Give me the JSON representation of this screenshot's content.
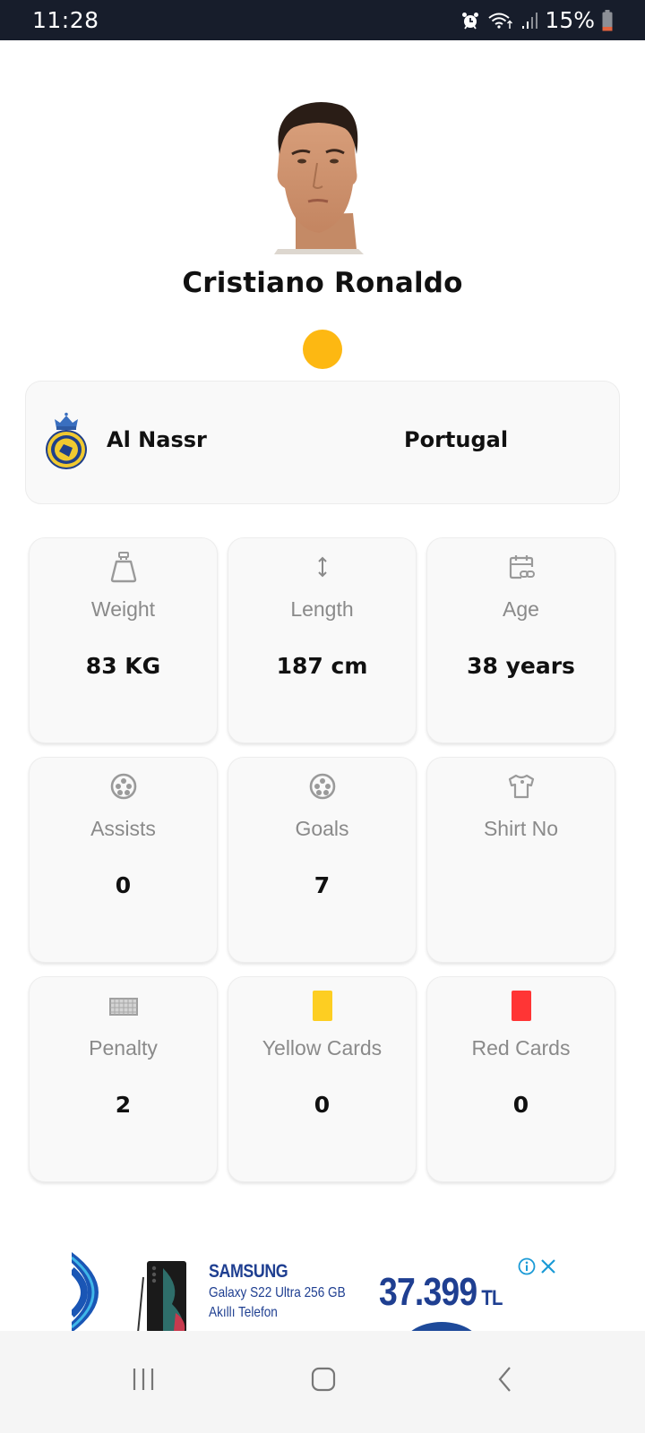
{
  "status_bar": {
    "time": "11:28",
    "battery_percent": "15%",
    "icons": [
      "alarm-icon",
      "wifi-icon",
      "signal-icon",
      "battery-icon"
    ]
  },
  "player": {
    "name": "Cristiano Ronaldo",
    "status_dot_color": "#fdb812"
  },
  "club_card": {
    "club_name": "Al Nassr",
    "country": "Portugal"
  },
  "stats": [
    {
      "icon": "weight-icon",
      "label": "Weight",
      "value": "83 KG"
    },
    {
      "icon": "height-arrows-icon",
      "label": "Length",
      "value": "187 cm"
    },
    {
      "icon": "calendar-age-icon",
      "label": "Age",
      "value": "38 years"
    },
    {
      "icon": "soccer-ball-icon",
      "label": "Assists",
      "value": "0"
    },
    {
      "icon": "soccer-ball-icon",
      "label": "Goals",
      "value": "7"
    },
    {
      "icon": "shirt-icon",
      "label": "Shirt No",
      "value": ""
    },
    {
      "icon": "goal-net-icon",
      "label": "Penalty",
      "value": "2"
    },
    {
      "icon": "yellow-card-icon",
      "label": "Yellow Cards",
      "value": "0"
    },
    {
      "icon": "red-card-icon",
      "label": "Red Cards",
      "value": "0"
    }
  ],
  "colors": {
    "yellow_card": "#fdce22",
    "red_card": "#ff3535",
    "icon_gray": "#9a9a9a"
  },
  "ad": {
    "brand": "SAMSUNG",
    "model": "Galaxy S22 Ultra 256 GB",
    "description": "Akıllı Telefon",
    "price": "37.399",
    "currency": "TL"
  },
  "nav_bar": {
    "buttons": [
      "recent-apps",
      "home",
      "back"
    ]
  }
}
